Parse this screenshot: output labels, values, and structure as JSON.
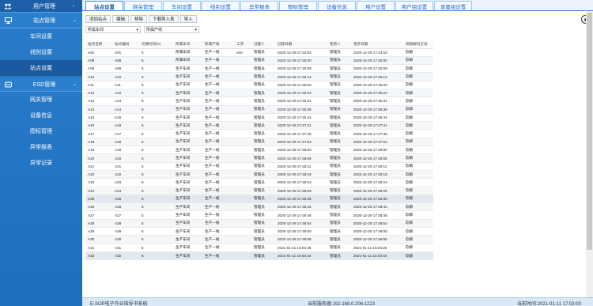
{
  "sidebar": {
    "header_label": "用户管理",
    "group1_label": "站点管理",
    "group1_items": [
      "车间设置",
      "线别设置",
      "站点设置"
    ],
    "group2_label": "ESD管理",
    "group2_items": [
      "网关管理",
      "设备信息",
      "图标管理",
      "异常报表",
      "异常记录"
    ]
  },
  "tabs": [
    "站点设置",
    "网关管理",
    "车间设置",
    "线别设置",
    "异常报表",
    "图标管理",
    "设备信息",
    "用户设置",
    "用户组设置",
    "隶属组设置"
  ],
  "toolbar": {
    "add": "添加站点",
    "edit": "编辑",
    "delete": "移除",
    "download": "下载导入表",
    "import": "导入"
  },
  "filters": {
    "workshop": "所属车间",
    "line": "所属产线"
  },
  "table": {
    "headers": [
      "站点名称",
      "站点编码",
      "切换时间(S)",
      "所属车间",
      "所属产线",
      "工序",
      "创建人",
      "创建日期",
      "更新人",
      "更新日期",
      "视频解码方式"
    ],
    "rows": [
      [
        "A01",
        "A01",
        "5",
        "所属车间",
        "生产一线",
        "one",
        "管理员",
        "2020-12-29 17:44:53",
        "管理员",
        "2020-12-29 17:44:53",
        "软解"
      ],
      [
        "A08",
        "A08",
        "5",
        "所属车间",
        "生产一线",
        "",
        "管理员",
        "2020-12-29 17:45:00",
        "管理员",
        "2020-12-29 17:45:00",
        "软解"
      ],
      [
        "A09",
        "A09",
        "5",
        "生产车间",
        "生产一线",
        "",
        "管理员",
        "2020-12-29 17:45:09",
        "管理员",
        "2020-12-29 17:45:09",
        "软解"
      ],
      [
        "A10",
        "A10",
        "5",
        "生产车间",
        "生产一线",
        "",
        "管理员",
        "2020-12-29 17:45:14",
        "管理员",
        "2020-12-29 17:45:14",
        "软解"
      ],
      [
        "A11",
        "A11",
        "5",
        "生产车间",
        "生产一线",
        "",
        "管理员",
        "2020-12-29 17:45:20",
        "管理员",
        "2020-12-29 17:45:20",
        "软解"
      ],
      [
        "A12",
        "A12",
        "5",
        "生产车间",
        "生产一线",
        "",
        "管理员",
        "2020-12-29 17:45:24",
        "管理员",
        "2020-12-29 17:45:24",
        "软解"
      ],
      [
        "A13",
        "A13",
        "5",
        "生产车间",
        "生产一线",
        "",
        "管理员",
        "2020-12-29 17:45:31",
        "管理员",
        "2020-12-29 17:45:31",
        "软解"
      ],
      [
        "A14",
        "A14",
        "5",
        "生产车间",
        "生产一线",
        "",
        "管理员",
        "2020-12-29 17:45:38",
        "管理员",
        "2020-12-29 17:45:38",
        "软解"
      ],
      [
        "A15",
        "A15",
        "5",
        "生产车间",
        "生产一线",
        "",
        "管理员",
        "2020-12-29 17:45:44",
        "管理员",
        "2020-12-29 17:45:44",
        "软解"
      ],
      [
        "A16",
        "A16",
        "5",
        "生产车间",
        "生产一线",
        "",
        "管理员",
        "2020-12-29 17:47:41",
        "管理员",
        "2020-12-29 17:47:41",
        "软解"
      ],
      [
        "A17",
        "A17",
        "5",
        "生产车间",
        "生产一线",
        "",
        "管理员",
        "2020-12-29 17:47:48",
        "管理员",
        "2020-12-29 17:47:48",
        "软解"
      ],
      [
        "A18",
        "A18",
        "5",
        "生产车间",
        "生产一线",
        "",
        "管理员",
        "2020-12-29 17:47:54",
        "管理员",
        "2020-12-29 17:47:54",
        "软解"
      ],
      [
        "A19",
        "A19",
        "5",
        "生产车间",
        "生产一线",
        "",
        "管理员",
        "2020-12-29 17:48:00",
        "管理员",
        "2020-12-29 17:48:00",
        "软解"
      ],
      [
        "A20",
        "A20",
        "5",
        "生产车间",
        "生产一线",
        "",
        "管理员",
        "2020-12-29 17:48:05",
        "管理员",
        "2020-12-29 17:48:05",
        "软解"
      ],
      [
        "A21",
        "A21",
        "5",
        "生产车间",
        "生产一线",
        "",
        "管理员",
        "2020-12-29 17:48:11",
        "管理员",
        "2020-12-29 17:48:11",
        "软解"
      ],
      [
        "A22",
        "A22",
        "5",
        "生产车间",
        "生产一线",
        "",
        "管理员",
        "2020-12-29 17:48:18",
        "管理员",
        "2020-12-29 17:48:18",
        "软解"
      ],
      [
        "A23",
        "A23",
        "5",
        "生产车间",
        "生产一线",
        "",
        "管理员",
        "2020-12-29 17:48:24",
        "管理员",
        "2020-12-29 17:48:24",
        "软解"
      ],
      [
        "A24",
        "A24",
        "5",
        "生产车间",
        "生产一线",
        "",
        "管理员",
        "2020-12-29 17:48:29",
        "管理员",
        "2020-12-29 17:48:29",
        "软解"
      ],
      [
        "A25",
        "A25",
        "5",
        "生产车间",
        "生产一线",
        "",
        "管理员",
        "2020-12-29 17:48:35",
        "管理员",
        "2020-12-29 17:48:35",
        "软解"
      ],
      [
        "A26",
        "A26",
        "5",
        "生产车间",
        "生产一线",
        "",
        "管理员",
        "2020-12-29 17:48:42",
        "管理员",
        "2020-12-29 17:48:42",
        "软解"
      ],
      [
        "A27",
        "A27",
        "5",
        "生产车间",
        "生产一线",
        "",
        "管理员",
        "2020-12-29 17:48:48",
        "管理员",
        "2020-12-29 17:48:48",
        "软解"
      ],
      [
        "A28",
        "A28",
        "5",
        "生产车间",
        "生产一线",
        "",
        "管理员",
        "2020-12-29 17:48:54",
        "管理员",
        "2020-12-29 17:48:54",
        "软解"
      ],
      [
        "A29",
        "A29",
        "5",
        "生产车间",
        "生产一线",
        "",
        "管理员",
        "2020-12-29 17:49:00",
        "管理员",
        "2020-12-29 17:49:00",
        "软解"
      ],
      [
        "A30",
        "A30",
        "5",
        "生产车间",
        "生产一线",
        "",
        "管理员",
        "2020-12-29 17:49:06",
        "管理员",
        "2020-12-29 17:49:06",
        "软解"
      ],
      [
        "A31",
        "A31",
        "5",
        "生产车间",
        "生产一线",
        "",
        "管理员",
        "2021-01-11 16:04:25",
        "管理员",
        "2021-01-11 16:04:25",
        "软解"
      ],
      [
        "A32",
        "A32",
        "5",
        "生产车间",
        "生产一线",
        "",
        "管理员",
        "2021-01-11 16:04:44",
        "管理员",
        "2021-01-11 16:04:44",
        "软解"
      ]
    ]
  },
  "footer": {
    "app_name": "E-SOP电子作业指导书系统",
    "server": "当前服务器:192.168.0.206:1223",
    "time": "当前时间:2021-01-11 17:53:00"
  }
}
